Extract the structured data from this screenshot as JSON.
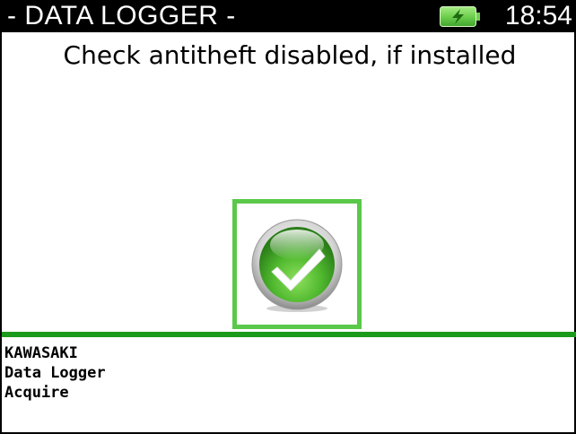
{
  "header": {
    "title": "- DATA LOGGER -",
    "time": "18:54",
    "battery_icon": "battery-charging-icon",
    "battery_color": "#6fcf4f"
  },
  "message": {
    "text": "Check antitheft disabled, if installed"
  },
  "confirm": {
    "icon": "check-icon",
    "accent": "#5ac84a"
  },
  "footer": {
    "lines": [
      "KAWASAKI",
      "Data Logger",
      "Acquire"
    ],
    "divider_color": "#1b9a1b"
  }
}
